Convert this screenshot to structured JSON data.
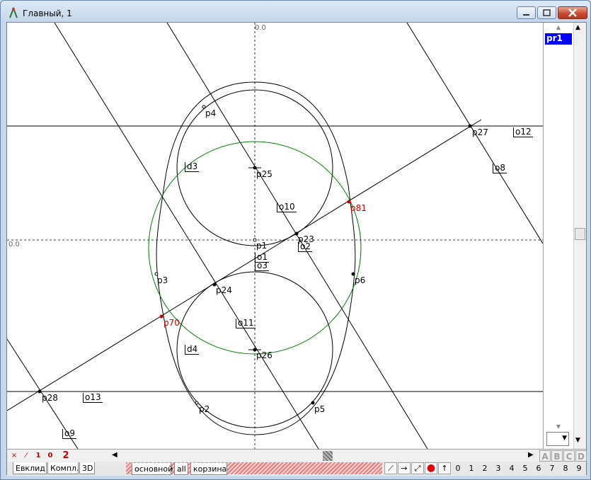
{
  "window": {
    "title": "Главный, 1"
  },
  "canvas": {
    "axis_top_label": "0.0",
    "axis_left_label": "0.0",
    "labels": {
      "p1": "p1",
      "p2": "p2",
      "p3": "p3",
      "p4": "p4",
      "p5": "p5",
      "p6": "p6",
      "p23": "p23",
      "p24": "p24",
      "p25": "p25",
      "p26": "p26",
      "p27": "p27",
      "p28": "p28",
      "p70": "p70",
      "p81": "p81",
      "d3": "d3",
      "d4": "d4",
      "o1": "o1",
      "o3": "o3",
      "o8": "o8",
      "o9": "o9",
      "o10": "o10",
      "o11": "o11",
      "o12": "o12",
      "o13": "o13",
      "o2": "o2"
    },
    "colors": {
      "line": "#000000",
      "circle_green": "#008000",
      "highlight_red": "#d00000",
      "axis": "#000000"
    }
  },
  "right_panel": {
    "list_items": [
      "pr1"
    ],
    "selected": "pr1"
  },
  "toolbar_row1": {
    "buttons": [
      "×",
      "⁄",
      "1",
      "0",
      "2"
    ],
    "abcd": [
      "A",
      "B",
      "C",
      "D"
    ]
  },
  "tabs_left": [
    "Евклид",
    "Компл.",
    "3D"
  ],
  "tabs_right": [
    "основной",
    "all",
    "корзина"
  ],
  "digits": [
    "0",
    "1",
    "2",
    "3",
    "4",
    "5",
    "6",
    "7",
    "8",
    "9"
  ],
  "icons": {
    "app": "compass-icon",
    "tools": [
      "segment-icon",
      "arrow-right-icon",
      "resize-icon",
      "red-dot-icon",
      "arrow-up-icon"
    ]
  }
}
